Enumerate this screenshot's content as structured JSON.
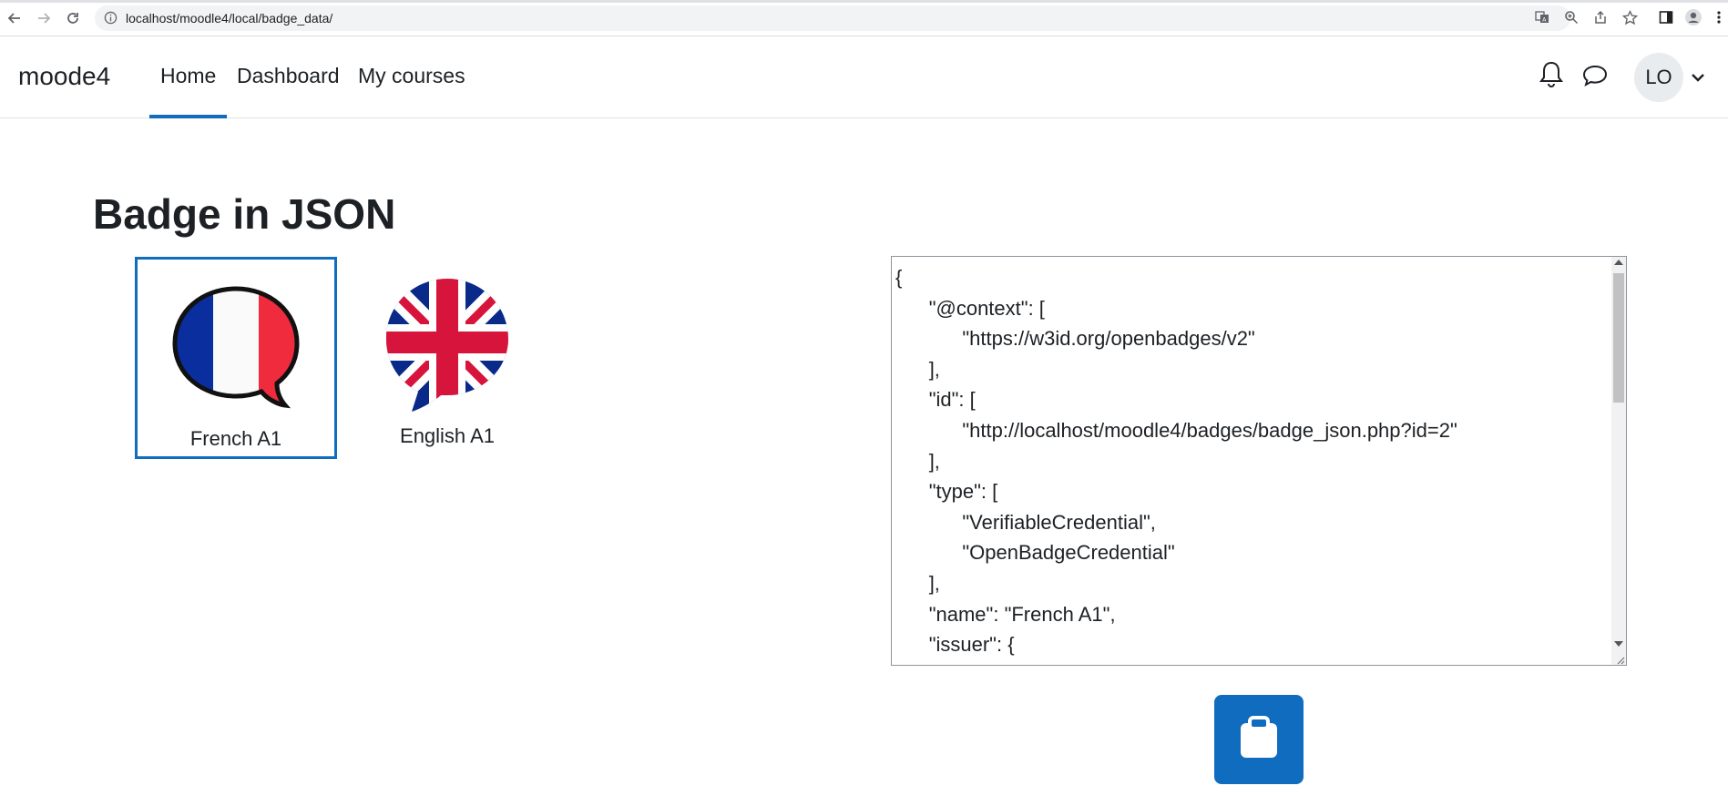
{
  "browser": {
    "url": "localhost/moodle4/local/badge_data/",
    "icons": [
      "back-icon",
      "forward-icon",
      "reload-icon",
      "info-icon",
      "translate-icon",
      "zoom-icon",
      "share-icon",
      "bookmark-star-icon",
      "side-panel-icon",
      "profile-icon",
      "menu-icon"
    ]
  },
  "navbar": {
    "brand": "moode4",
    "links": [
      "Home",
      "Dashboard",
      "My courses"
    ],
    "active": "Home",
    "avatar_initials": "LO"
  },
  "main": {
    "title": "Badge in JSON",
    "badges": [
      {
        "label": "French A1",
        "selected": true,
        "icon": "france-flag-speech-bubble-icon"
      },
      {
        "label": "English A1",
        "selected": false,
        "icon": "uk-flag-speech-bubble-icon"
      }
    ],
    "json_text": "{\n\t\"@context\": [\n\t\t\"https://w3id.org/openbadges/v2\"\n\t],\n\t\"id\": [\n\t\t\"http://localhost/moodle4/badges/badge_json.php?id=2\"\n\t],\n\t\"type\": [\n\t\t\"VerifiableCredential\",\n\t\t\"OpenBadgeCredential\"\n\t],\n\t\"name\": \"French A1\",\n\t\"issuer\": {",
    "copy_button_icon": "clipboard-icon"
  },
  "colors": {
    "accent": "#0f6cbf",
    "text": "#1d2125"
  }
}
